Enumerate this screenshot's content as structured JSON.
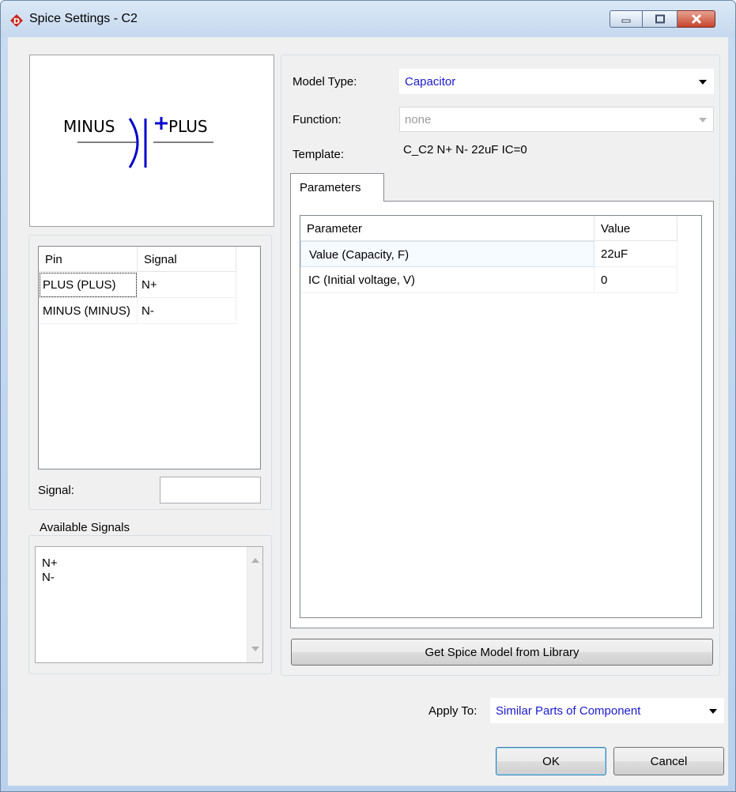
{
  "window": {
    "title": "Spice Settings - C2"
  },
  "preview": {
    "minus_label": "MINUS",
    "plus_label": "PLUS",
    "symbol_color": "#0000cc"
  },
  "pins": {
    "headers": [
      "Pin",
      "Signal"
    ],
    "rows": [
      {
        "pin": "PLUS (PLUS)",
        "signal": "N+"
      },
      {
        "pin": "MINUS (MINUS)",
        "signal": "N-"
      }
    ]
  },
  "signal": {
    "label": "Signal:",
    "value": ""
  },
  "available_signals": {
    "label": "Available Signals",
    "items": [
      "N+",
      "N-"
    ]
  },
  "model": {
    "type_label": "Model Type:",
    "type_value": "Capacitor",
    "function_label": "Function:",
    "function_value": "none",
    "template_label": "Template:",
    "template_value": "C_C2 N+ N- 22uF IC=0"
  },
  "params": {
    "tab_label": "Parameters",
    "headers": [
      "Parameter",
      "Value"
    ],
    "rows": [
      {
        "name": "Value (Capacity, F)",
        "value": "22uF"
      },
      {
        "name": "IC (Initial voltage, V)",
        "value": "0"
      }
    ]
  },
  "library_button": "Get Spice Model from Library",
  "apply": {
    "label": "Apply To:",
    "value": "Similar Parts of Component"
  },
  "buttons": {
    "ok": "OK",
    "cancel": "Cancel"
  },
  "colors": {
    "link_blue": "#1a1ad0",
    "disabled_text": "#9a9a9a"
  }
}
